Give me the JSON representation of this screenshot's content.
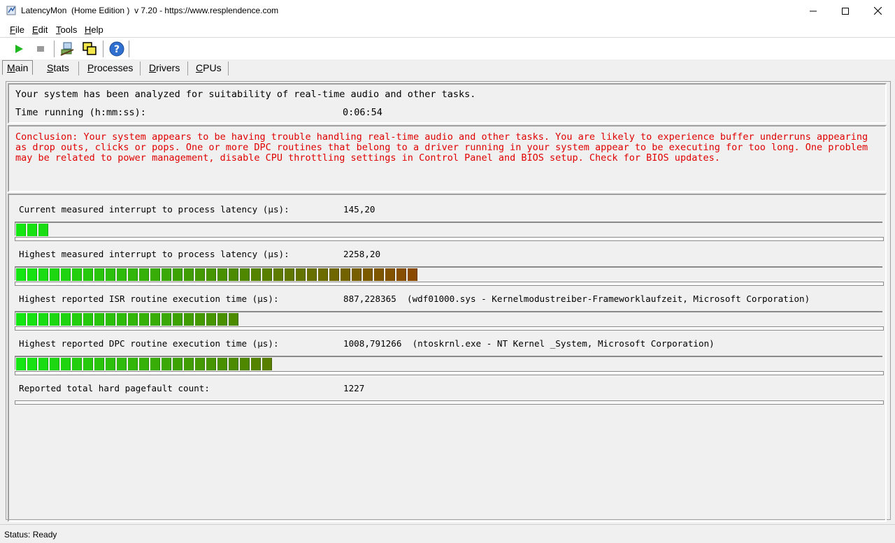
{
  "window": {
    "title": "LatencyMon  (Home Edition )  v 7.20 - https://www.resplendence.com",
    "minimize_icon": "minimize-icon",
    "maximize_icon": "maximize-icon",
    "close_icon": "close-icon"
  },
  "menu": {
    "items": [
      {
        "accel": "F",
        "rest": "ile"
      },
      {
        "accel": "E",
        "rest": "dit"
      },
      {
        "accel": "T",
        "rest": "ools"
      },
      {
        "accel": "H",
        "rest": "elp"
      }
    ]
  },
  "toolbar": {
    "start_icon": "play-icon",
    "stop_icon": "stop-icon",
    "monitor_icon": "monitor-icon",
    "windows_icon": "windows-icon",
    "help_icon": "help-icon"
  },
  "tabs": [
    {
      "accel": "M",
      "rest": "ain",
      "active": true
    },
    {
      "accel": "S",
      "rest": "tats",
      "active": false
    },
    {
      "accel": "P",
      "rest": "rocesses",
      "active": false
    },
    {
      "accel": "D",
      "rest": "rivers",
      "active": false
    },
    {
      "accel": "C",
      "rest": "PUs",
      "active": false
    }
  ],
  "summary": {
    "analyzed_text": "Your system has been analyzed for suitability of real-time audio and other tasks.",
    "time_running_label": "Time running (h:mm:ss):",
    "time_running_value": "0:06:54"
  },
  "conclusion": {
    "text": "Conclusion: Your system appears to be having trouble handling real-time audio and other tasks. You are likely to experience buffer underruns appearing as drop outs, clicks or pops. One or more DPC routines that belong to a driver running in your system appear to be executing for too long. One problem may be related to power management, disable CPU throttling settings in Control Panel and BIOS setup. Check for BIOS updates.",
    "color": "#e00000"
  },
  "metrics": [
    {
      "label": "Current measured interrupt to process latency (µs):",
      "value": "145,20",
      "segments": 3
    },
    {
      "label": "Highest measured interrupt to process latency (µs):",
      "value": "2258,20",
      "segments": 36
    },
    {
      "label": "Highest reported ISR routine execution time (µs):",
      "value": "887,228365  (wdf01000.sys - Kernelmodustreiber-Frameworklaufzeit, Microsoft Corporation)",
      "segments": 20
    },
    {
      "label": "Highest reported DPC routine execution time (µs):",
      "value": "1008,791266  (ntoskrnl.exe - NT Kernel _System, Microsoft Corporation)",
      "segments": 23
    },
    {
      "label": "Reported total hard pagefault count:",
      "value": "1227",
      "segments": 0
    }
  ],
  "bar_colors": {
    "start": "#14e614",
    "mid": "#4d8a00",
    "end": "#8a4a00"
  },
  "status": {
    "text": "Status: Ready"
  }
}
